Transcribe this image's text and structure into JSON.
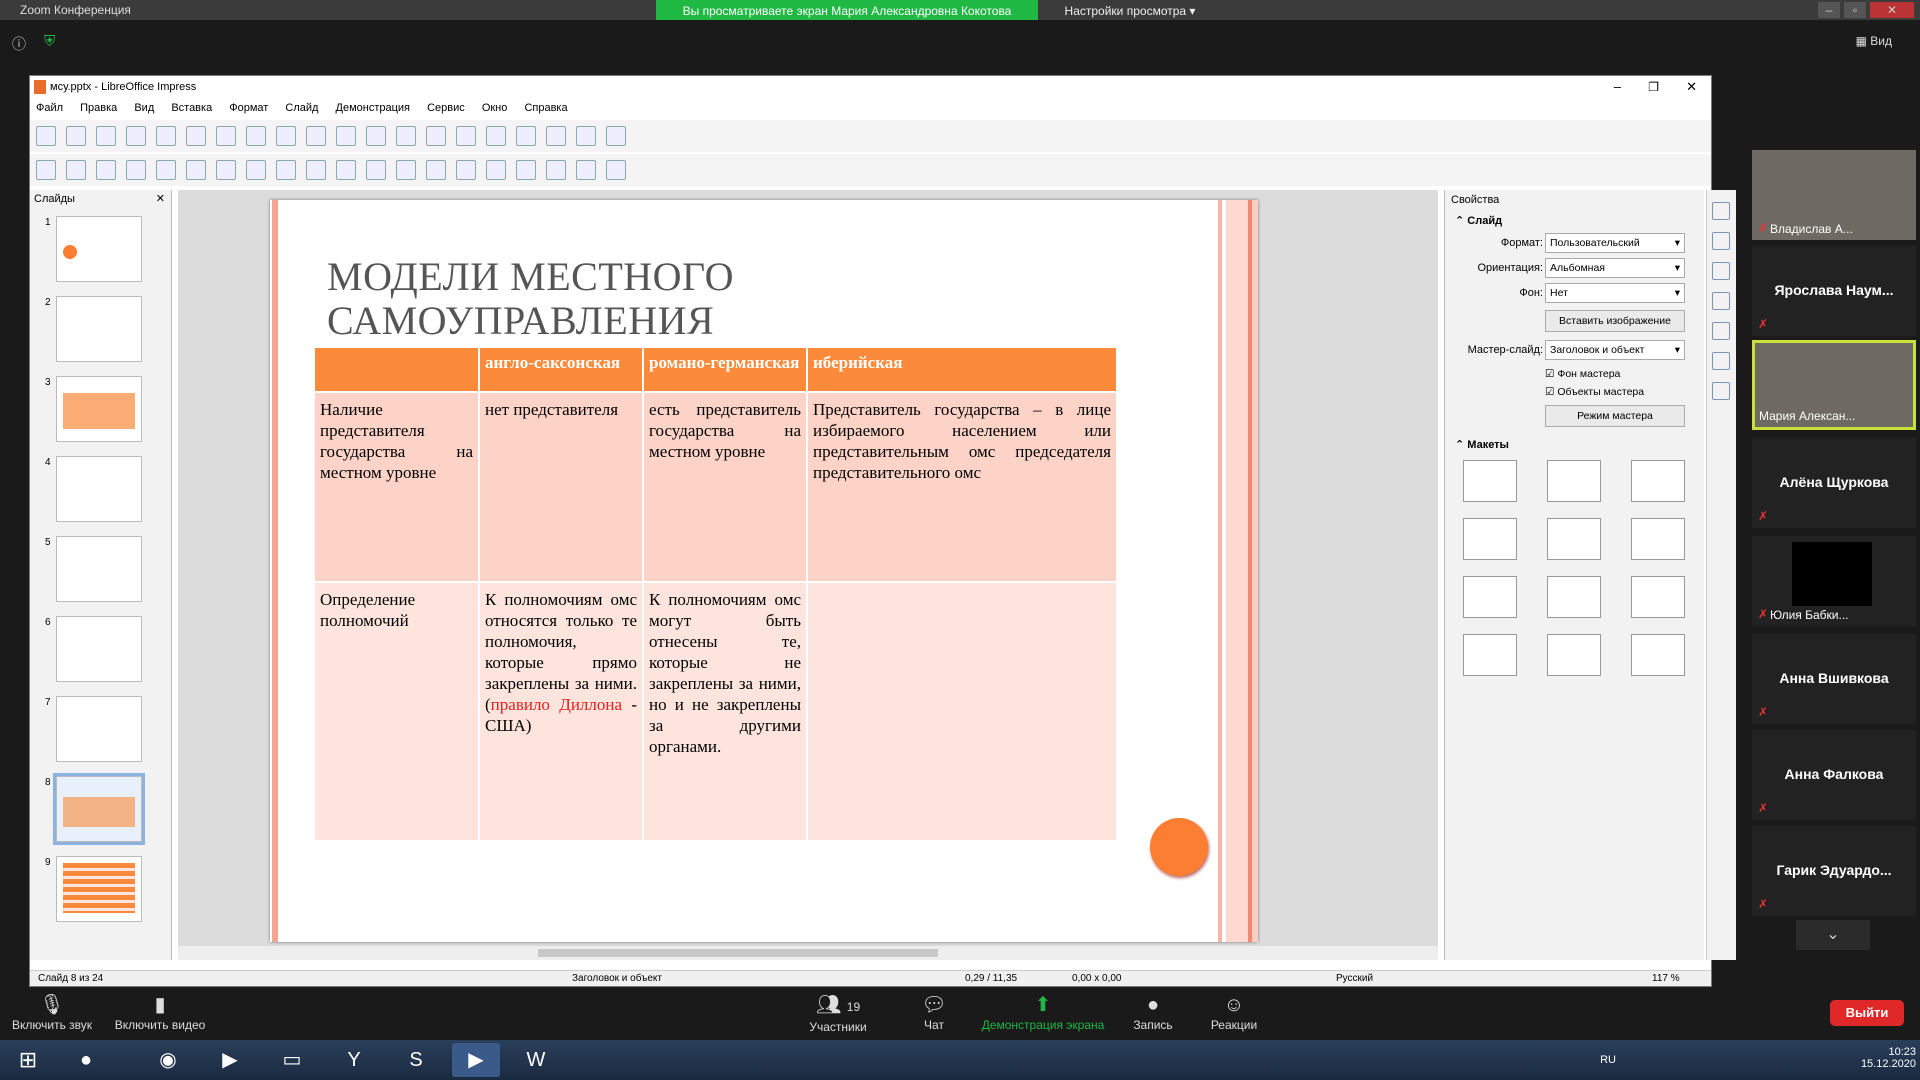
{
  "zoom": {
    "window_title": "Zoom Конференция",
    "banner": "Вы просматриваете экран Мария Александровна Кокотова",
    "view_settings": "Настройки просмотра",
    "view_button": "Вид",
    "controls": {
      "mute": "Включить звук",
      "video": "Включить видео",
      "participants": "Участники",
      "participants_count": "19",
      "chat": "Чат",
      "share": "Демонстрация экрана",
      "record": "Запись",
      "reactions": "Реакции",
      "exit": "Выйти"
    },
    "participants": [
      {
        "name": "Владислав А...",
        "video": true
      },
      {
        "name": "Ярослава Наум...",
        "video": false
      },
      {
        "name": "Мария Алексан...",
        "video": true,
        "active": true
      },
      {
        "name": "Алёна Щуркова",
        "video": false
      },
      {
        "name": "Юлия Бабки...",
        "video": true
      },
      {
        "name": "Анна Вшивкова",
        "video": false
      },
      {
        "name": "Анна Фалкова",
        "video": false
      },
      {
        "name": "Гарик  Эдуардо...",
        "video": false
      }
    ]
  },
  "lo": {
    "title": "мсу.pptx - LibreOffice Impress",
    "menu": [
      "Файл",
      "Правка",
      "Вид",
      "Вставка",
      "Формат",
      "Слайд",
      "Демонстрация",
      "Сервис",
      "Окно",
      "Справка"
    ],
    "slides_pane_title": "Слайды",
    "slide_numbers": [
      "1",
      "2",
      "3",
      "4",
      "5",
      "6",
      "7",
      "8",
      "9"
    ],
    "selected_slide": 8,
    "slide": {
      "title_line1": "МОДЕЛИ МЕСТНОГО",
      "title_line2": "САМОУПРАВЛЕНИЯ",
      "table": {
        "headers": [
          "",
          "англо-саксонская",
          "романо-германская",
          "иберийская"
        ],
        "row1": [
          "Наличие представителя государства на местном уровне",
          "нет представителя",
          "есть представитель государства на местном уровне",
          "Представитель государства – в лице избираемого населением или представительным омс председателя представительного омс"
        ],
        "row2": {
          "c0": "Определение полномочий",
          "c1_a": "К полномочиям омс относятся только те полномочия, которые прямо закреплены за ними. (",
          "c1_red": "правило Диллона",
          "c1_b": " - США)",
          "c2": "К полномочиям омс могут быть отнесены те, которые не закреплены за ними, но и не закреплены за другими органами.",
          "c3": ""
        }
      }
    },
    "properties": {
      "title": "Свойства",
      "section_slide": "Слайд",
      "format_label": "Формат:",
      "format_value": "Пользовательский",
      "orientation_label": "Ориентация:",
      "orientation_value": "Альбомная",
      "background_label": "Фон:",
      "background_value": "Нет",
      "insert_image": "Вставить изображение",
      "master_label": "Мастер-слайд:",
      "master_value": "Заголовок и объект",
      "master_bg": "Фон мастера",
      "master_objects": "Объекты мастера",
      "master_mode": "Режим мастера",
      "section_layouts": "Макеты"
    },
    "status": {
      "slide": "Слайд 8 из 24",
      "layout": "Заголовок и объект",
      "position": "0,29 / 11,35",
      "size": "0,00 x 0,00",
      "language": "Русский",
      "zoom": "117 %"
    }
  },
  "taskbar": {
    "lang": "RU",
    "time": "10:23",
    "date": "15.12.2020"
  }
}
